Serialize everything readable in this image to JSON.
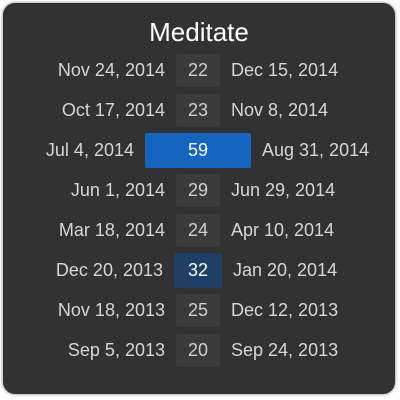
{
  "title": "Meditate",
  "colors": {
    "card_background": "#323232",
    "streak_neutral": "#3b3b3b",
    "streak_current": "#1565c0",
    "streak_best": "#1f3f66",
    "text": "#d6d6d6"
  },
  "streaks": [
    {
      "start": "Nov 24, 2014",
      "length": "22",
      "end": "Dec 15, 2014",
      "state": "normal"
    },
    {
      "start": "Oct 17, 2014",
      "length": "23",
      "end": "Nov 8, 2014",
      "state": "normal"
    },
    {
      "start": "Jul 4, 2014",
      "length": "59",
      "end": "Aug 31, 2014",
      "state": "current"
    },
    {
      "start": "Jun 1, 2014",
      "length": "29",
      "end": "Jun 29, 2014",
      "state": "normal"
    },
    {
      "start": "Mar 18, 2014",
      "length": "24",
      "end": "Apr 10, 2014",
      "state": "normal"
    },
    {
      "start": "Dec 20, 2013",
      "length": "32",
      "end": "Jan 20, 2014",
      "state": "best"
    },
    {
      "start": "Nov 18, 2013",
      "length": "25",
      "end": "Dec 12, 2013",
      "state": "normal"
    },
    {
      "start": "Sep 5, 2013",
      "length": "20",
      "end": "Sep 24, 2013",
      "state": "normal"
    }
  ]
}
